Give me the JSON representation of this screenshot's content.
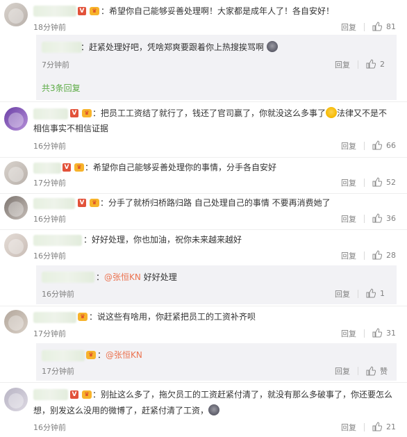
{
  "reply_label": "回复",
  "like_label_zan": "赞",
  "comments": [
    {
      "text": "希望你自己能够妥善处理啊！大家都是成年人了！各自安好！",
      "time": "18分钟前",
      "likes": "81"
    },
    {
      "sub": true,
      "text": "赶紧处理好吧，凭啥郑爽要跟着你上热搜挨骂啊",
      "time": "7分钟前",
      "likes": "2"
    },
    {
      "expand": "共3条回复"
    },
    {
      "text1": "把员工工资结了就行了，钱还了官司赢了，你就没这么多事了",
      "text1b": "法律又不是不",
      "text2": "相信事实不相信证据",
      "time": "16分钟前",
      "likes": "66"
    },
    {
      "text": "希望你自己能够妥善处理你的事情，分手各自安好",
      "time": "17分钟前",
      "likes": "52"
    },
    {
      "text": "分手了就桥归桥路归路 自己处理自己的事情 不要再消费她了",
      "time": "16分钟前",
      "likes": "36"
    },
    {
      "text": "好好处理，你也加油，祝你未来越来越好",
      "time": "16分钟前",
      "likes": "28"
    },
    {
      "sub": true,
      "mention": "@张恒KN",
      "text": "好好处理",
      "time": "16分钟前",
      "likes": "1"
    },
    {
      "text": "说这些有啥用，你赶紧把员工的工资补齐呗",
      "time": "17分钟前",
      "likes": "31"
    },
    {
      "sub": true,
      "mention": "@张恒KN",
      "time": "17分钟前",
      "likes": "赞"
    },
    {
      "text1": "别扯这么多了，拖欠员工的工资赶紧付清了，就没有那么多破事了，你还要怎么",
      "text2": "想，别发这么没用的微博了，赶紧付清了工资，",
      "time": "16分钟前",
      "likes": "21"
    }
  ]
}
